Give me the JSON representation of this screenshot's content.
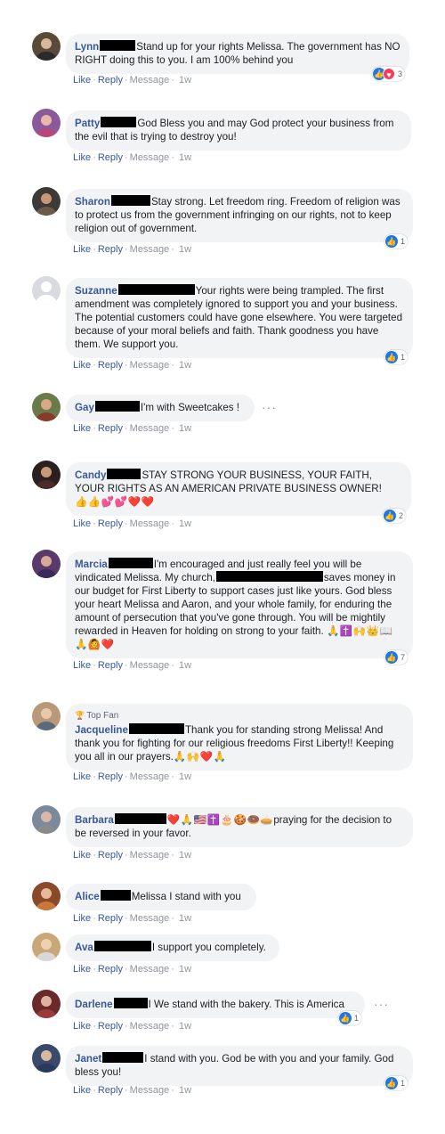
{
  "actions": {
    "like": "Like",
    "reply": "Reply",
    "message": "Message",
    "sep": "·"
  },
  "top_fan_label": "Top Fan",
  "comments": [
    {
      "name": "Lynn",
      "text": "Stand up for your rights Melissa. The government has NO RIGHT doing this to you. I am 100% behind you",
      "time": "1w",
      "reaction_count": "3",
      "avatar_color": "#5a4a3a"
    },
    {
      "name": "Patty",
      "text": "God Bless you and may God protect your business from the evil that is trying to destroy you!",
      "time": "1w",
      "avatar_color": "#8a5a9a"
    },
    {
      "name": "Sharon",
      "text": "Stay strong. Let freedom ring. Freedom of religion was to protect us from the government infringing on our rights, not to keep religion out of government.",
      "time": "1w",
      "reaction_count": "1",
      "avatar_color": "#3e3a36"
    },
    {
      "name": "Suzanne",
      "text": "Your rights were being trampled. The first amendment was completely ignored to support you and your business. The potential customers could have gone elsewhere. You were targeted because of your moral beliefs and faith. Thank goodness you have them. We support you.",
      "time": "1w",
      "reaction_count": "1",
      "avatar_color": "#d8dadf"
    },
    {
      "name": "Gay",
      "text": "I'm with Sweetcakes !",
      "time": "1w",
      "avatar_color": "#6b7a4a"
    },
    {
      "name": "Candy",
      "text": "STAY STRONG YOUR BUSINESS, YOUR FAITH, YOUR RIGHTS AS AN AMERICAN PRIVATE BUSINESS OWNER!",
      "emoji": "👍👍💕💕❤️❤️",
      "time": "1w",
      "reaction_count": "2",
      "avatar_color": "#2a2020"
    },
    {
      "name": "Marcia",
      "text": "I'm encouraged and just really feel you will be vindicated Melissa. My church,",
      "text2": "saves money in our budget for First Liberty to support cases just like yours. God bless your heart Melissa and Aaron, and your whole family, for enduring the amount of persecution that you've gone through. You will be mightily rewarded in Heaven for holding on strong to your faith.",
      "emoji": "🙏✝️🙌👑📖🙏🙆❤️",
      "time": "1w",
      "reaction_count": "7",
      "avatar_color": "#5a3a6a"
    },
    {
      "name": "Jacqueline",
      "text": "Thank you for standing strong Melissa! And thank you for fighting for our religious freedoms First Liberty!! Keeping you all in our prayers.",
      "emoji": "🙏🙌❤️🙏",
      "time": "1w",
      "avatar_color": "#b89a7a"
    },
    {
      "name": "Barbara",
      "emoji": "❤️🙏🇺🇸✝️🎂🍪🍩🥧",
      "text": "praying for the decision to be reversed in your favor.",
      "time": "1w",
      "avatar_color": "#7a8a9a"
    },
    {
      "name": "Alice",
      "text": "Melissa I stand with you",
      "time": "1w",
      "avatar_color": "#8a4a2a"
    },
    {
      "name": "Ava",
      "text": "I support you completely.",
      "time": "1w",
      "avatar_color": "#c8a878"
    },
    {
      "name": "Darlene",
      "text": "I We stand with the bakery. This is America",
      "time": "1w",
      "reaction_count": "1",
      "avatar_color": "#6a2a2a"
    },
    {
      "name": "Janet",
      "text": "I stand with you. God be with you and your family. God bless you!",
      "time": "1w",
      "reaction_count": "1",
      "avatar_color": "#3a4a6a"
    }
  ]
}
